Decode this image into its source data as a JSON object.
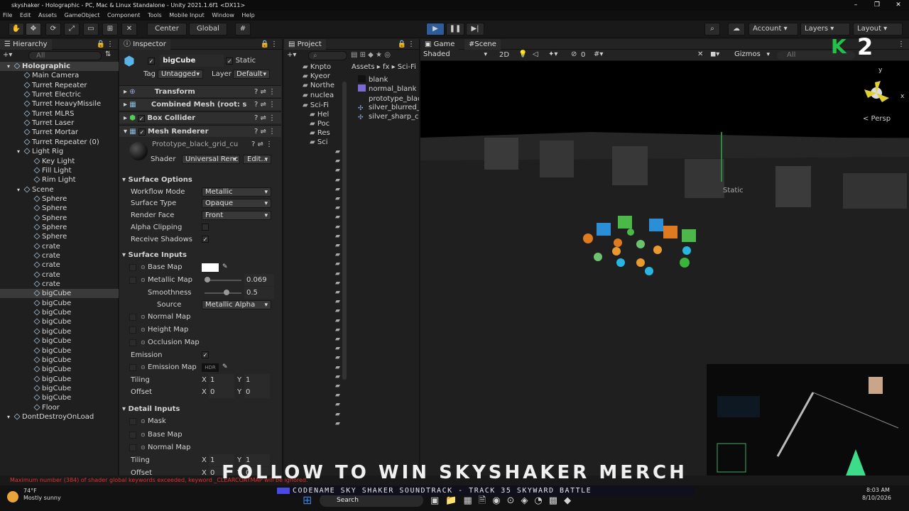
{
  "window": {
    "title": "skyshaker - Holographic - PC, Mac & Linux Standalone - Unity 2021.1.6f1 <DX11>"
  },
  "menu": [
    "File",
    "Edit",
    "Assets",
    "GameObject",
    "Component",
    "Tools",
    "Mobile Input",
    "Window",
    "Help"
  ],
  "toolbar": {
    "center": "Center",
    "global": "Global",
    "account": "Account",
    "layers": "Layers",
    "layout": "Layout"
  },
  "hierarchy": {
    "title": "Hierarchy",
    "search_placeholder": "All",
    "items": [
      {
        "label": "Holographic",
        "indent": 0,
        "bold": true,
        "sel": true
      },
      {
        "label": "Main Camera",
        "indent": 1
      },
      {
        "label": "Turret Repeater",
        "indent": 1
      },
      {
        "label": "Turret Electric",
        "indent": 1
      },
      {
        "label": "Turret HeavyMissile",
        "indent": 1
      },
      {
        "label": "Turret MLRS",
        "indent": 1
      },
      {
        "label": "Turret Laser",
        "indent": 1
      },
      {
        "label": "Turret Mortar",
        "indent": 1
      },
      {
        "label": "Turret Repeater (0)",
        "indent": 1
      },
      {
        "label": "Light Rig",
        "indent": 1
      },
      {
        "label": "Key Light",
        "indent": 2
      },
      {
        "label": "Fill Light",
        "indent": 2
      },
      {
        "label": "Rim Light",
        "indent": 2
      },
      {
        "label": "Scene",
        "indent": 1
      },
      {
        "label": "Sphere",
        "indent": 2
      },
      {
        "label": "Sphere",
        "indent": 2
      },
      {
        "label": "Sphere",
        "indent": 2
      },
      {
        "label": "Sphere",
        "indent": 2
      },
      {
        "label": "Sphere",
        "indent": 2
      },
      {
        "label": "crate",
        "indent": 2
      },
      {
        "label": "crate",
        "indent": 2
      },
      {
        "label": "crate",
        "indent": 2
      },
      {
        "label": "crate",
        "indent": 2
      },
      {
        "label": "crate",
        "indent": 2
      },
      {
        "label": "bigCube",
        "indent": 2,
        "sel": true
      },
      {
        "label": "bigCube",
        "indent": 2
      },
      {
        "label": "bigCube",
        "indent": 2
      },
      {
        "label": "bigCube",
        "indent": 2
      },
      {
        "label": "bigCube",
        "indent": 2
      },
      {
        "label": "bigCube",
        "indent": 2
      },
      {
        "label": "bigCube",
        "indent": 2
      },
      {
        "label": "bigCube",
        "indent": 2
      },
      {
        "label": "bigCube",
        "indent": 2
      },
      {
        "label": "bigCube",
        "indent": 2
      },
      {
        "label": "bigCube",
        "indent": 2
      },
      {
        "label": "bigCube",
        "indent": 2
      },
      {
        "label": "Floor",
        "indent": 2
      },
      {
        "label": "DontDestroyOnLoad",
        "indent": 0
      }
    ]
  },
  "inspector": {
    "title": "Inspector",
    "object": "bigCube",
    "static": "Static",
    "tag_label": "Tag",
    "tag": "Untagged",
    "layer_label": "Layer",
    "layer": "Default",
    "components": [
      "Transform",
      "Combined Mesh (root: s",
      "Box Collider",
      "Mesh Renderer"
    ],
    "material": "Prototype_black_grid_cu",
    "shader_label": "Shader",
    "shader": "Universal Renc",
    "edit": "Edit...",
    "surface_options": "Surface Options",
    "workflow_label": "Workflow Mode",
    "workflow": "Metallic",
    "surface_type_label": "Surface Type",
    "surface_type": "Opaque",
    "render_face_label": "Render Face",
    "render_face": "Front",
    "alpha_clipping": "Alpha Clipping",
    "receive_shadows": "Receive Shadows",
    "surface_inputs": "Surface Inputs",
    "base_map": "Base Map",
    "metallic_map": "Metallic Map",
    "metallic_value": "0.069",
    "smoothness": "Smoothness",
    "smoothness_value": "0.5",
    "source_label": "Source",
    "source": "Metallic Alpha",
    "normal_map": "Normal Map",
    "height_map": "Height Map",
    "occlusion_map": "Occlusion Map",
    "emission": "Emission",
    "emission_map": "Emission Map",
    "hdr": "HDR",
    "tiling": "Tiling",
    "offset": "Offset",
    "x": "X",
    "y": "Y",
    "one": "1",
    "zero": "0",
    "detail_inputs": "Detail Inputs",
    "mask": "Mask",
    "detail_base_map": "Base Map",
    "detail_normal_map": "Normal Map",
    "tiling2": "Tiling",
    "offset2": "Offset"
  },
  "project": {
    "title": "Project",
    "folders": [
      "Knpto",
      "Kyeor",
      "Northe",
      "nuclea",
      "Sci-Fi",
      "Hel",
      "Poc",
      "Res",
      "Sci"
    ],
    "breadcrumb": [
      "Assets",
      "fx",
      "Sci-Fi"
    ],
    "files": [
      "blank",
      "normal_blank",
      "prototype_blac",
      "silver_blurred_c",
      "silver_sharp_cu"
    ]
  },
  "scene": {
    "game_tab": "Game",
    "scene_tab": "Scene",
    "shaded": "Shaded",
    "twod": "2D",
    "vis_count": "0",
    "gizmos": "Gizmos",
    "search_placeholder": "All",
    "persp": "< Persp",
    "static_label": "Static",
    "axis_x": "x",
    "axis_y": "y"
  },
  "status": {
    "message": "Maximum number (384) of shader global keywords exceeded, keyword _CLEARCOATMAP will be ignored."
  },
  "overlay": {
    "text": "FOLLOW TO WIN SKYSHAKER MERCH",
    "ticker": "CODENAME SKY SHAKER SOUNDTRACK - TRACK 35 SKYWARD BATTLE",
    "badge": "2"
  },
  "taskbar": {
    "temp": "74°F",
    "weather": "Mostly sunny",
    "search": "Search",
    "time": "8:03 AM",
    "date": "8/10/2026"
  },
  "colors": {
    "accent": "#3a7fd9",
    "logo_green": "#22c24a",
    "error": "#e33030"
  }
}
